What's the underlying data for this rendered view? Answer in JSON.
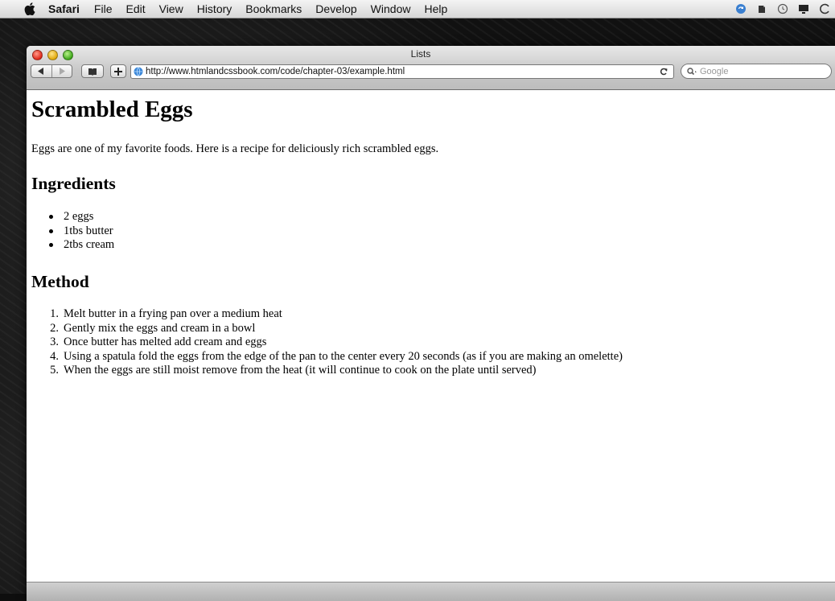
{
  "menubar": {
    "app": "Safari",
    "items": [
      "File",
      "Edit",
      "View",
      "History",
      "Bookmarks",
      "Develop",
      "Window",
      "Help"
    ],
    "status_icons": [
      "sync-icon",
      "evernote-icon",
      "timer-icon",
      "display-icon",
      "clock-icon"
    ]
  },
  "window": {
    "title": "Lists",
    "toolbar": {
      "url": "http://www.htmlandcssbook.com/code/chapter-03/example.html",
      "search_placeholder": "Google"
    }
  },
  "page": {
    "heading": "Scrambled Eggs",
    "intro": "Eggs are one of my favorite foods. Here is a recipe for deliciously rich scrambled eggs.",
    "ingredients_heading": "Ingredients",
    "ingredients": [
      "2 eggs",
      "1tbs butter",
      "2tbs cream"
    ],
    "method_heading": "Method",
    "method_numbers": [
      "1.",
      "2.",
      "3.",
      "4.",
      "5."
    ],
    "method": [
      "Melt butter in a frying pan over a medium heat",
      "Gently mix the eggs and cream in a bowl",
      "Once butter has melted add cream and eggs",
      "Using a spatula fold the eggs from the edge of the pan to the center every 20 seconds (as if you are making an omelette)",
      "When the eggs are still moist remove from the heat (it will continue to cook on the plate until served)"
    ]
  }
}
